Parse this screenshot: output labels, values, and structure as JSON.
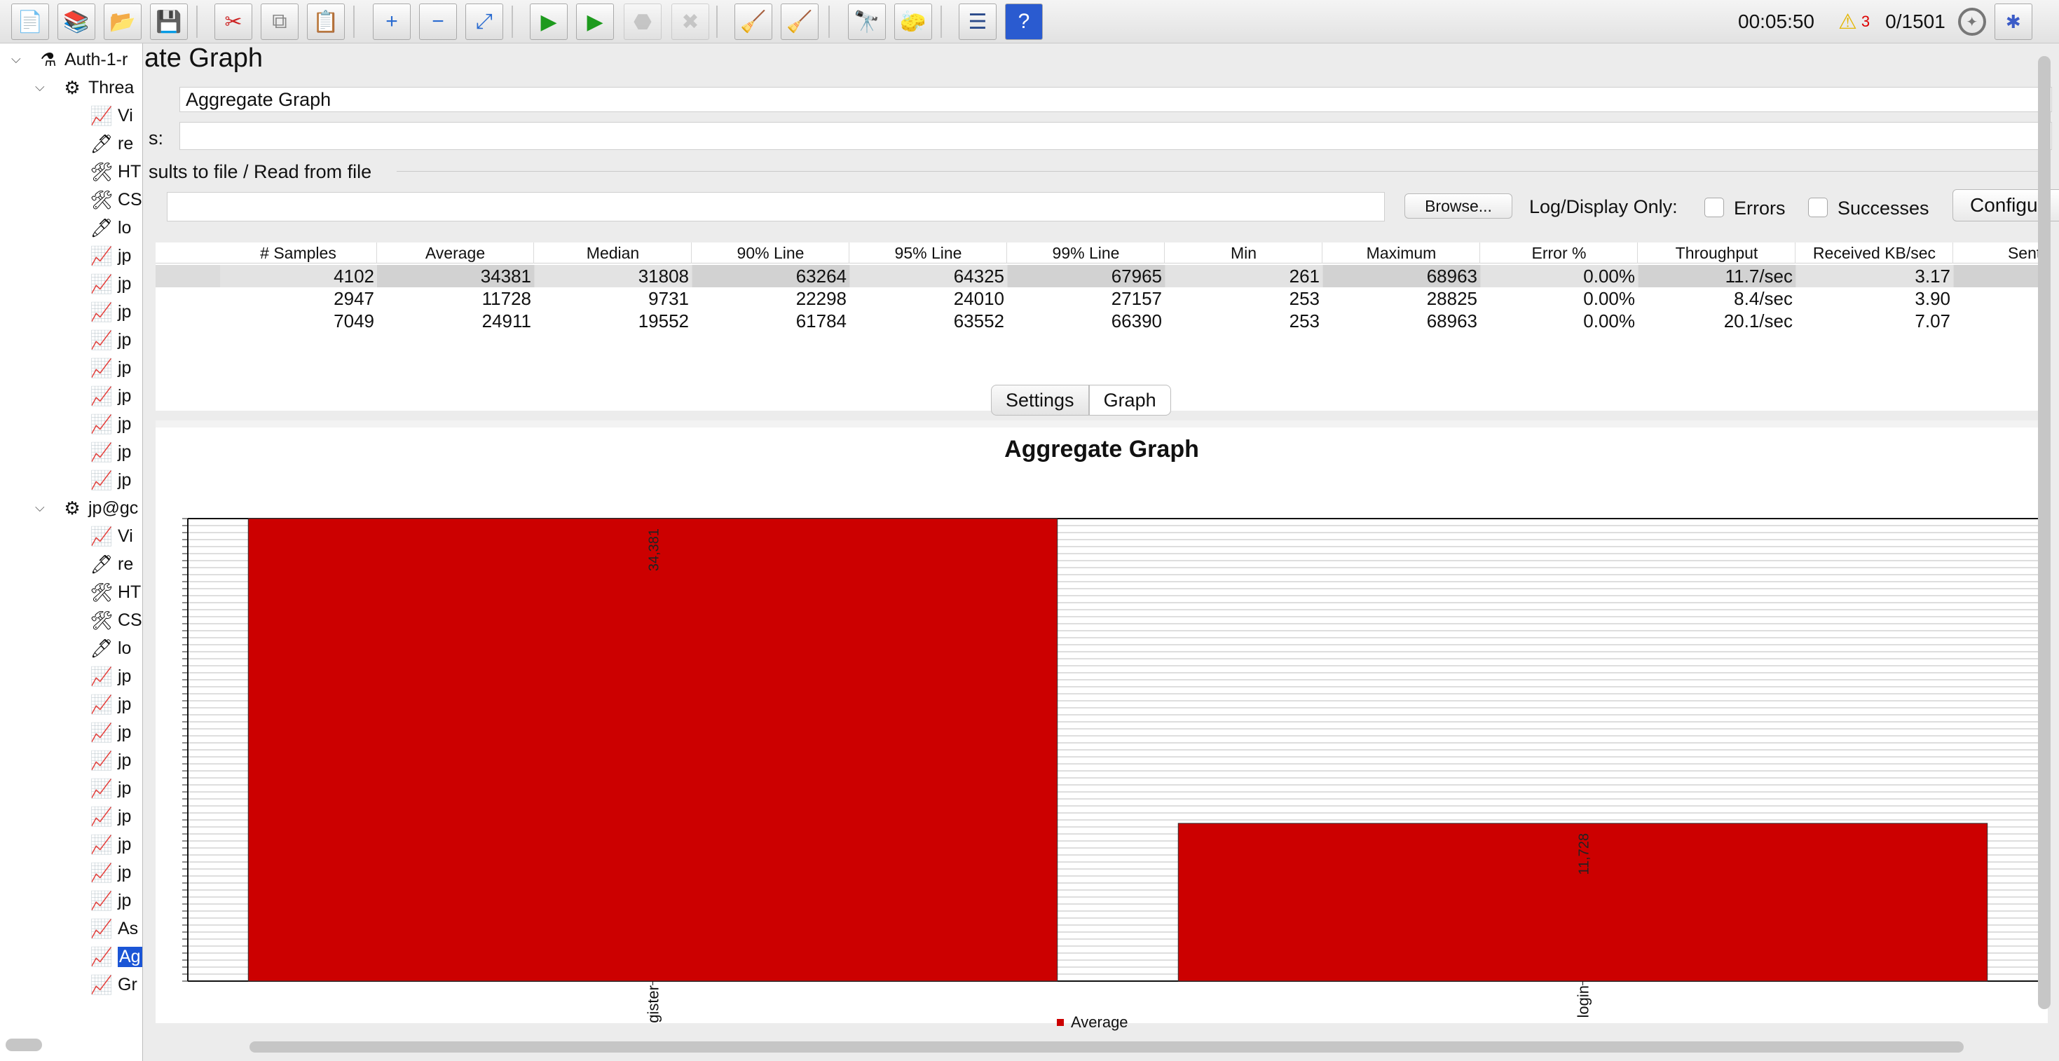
{
  "toolbar": {
    "buttons": [
      {
        "name": "new-icon",
        "glyph": "📄"
      },
      {
        "name": "templates-icon",
        "glyph": "📚"
      },
      {
        "name": "open-icon",
        "glyph": "📂"
      },
      {
        "name": "save-icon",
        "glyph": "💾"
      },
      {
        "name": "cut-icon",
        "glyph": "✂"
      },
      {
        "name": "copy-icon",
        "glyph": "⧉"
      },
      {
        "name": "paste-icon",
        "glyph": "📋"
      },
      {
        "name": "expand-icon",
        "glyph": "+"
      },
      {
        "name": "collapse-icon",
        "glyph": "−"
      },
      {
        "name": "toggle-icon",
        "glyph": "⤢"
      },
      {
        "name": "start-icon",
        "glyph": "▶"
      },
      {
        "name": "start-no-pauses-icon",
        "glyph": "▶"
      },
      {
        "name": "stop-icon",
        "glyph": "⬣"
      },
      {
        "name": "shutdown-icon",
        "glyph": "✖"
      },
      {
        "name": "clear-icon",
        "glyph": "🧹"
      },
      {
        "name": "clear-all-icon",
        "glyph": "🧹"
      },
      {
        "name": "search-icon",
        "glyph": "🔭"
      },
      {
        "name": "reset-search-icon",
        "glyph": "🧽"
      },
      {
        "name": "function-helper-icon",
        "glyph": "☰"
      },
      {
        "name": "help-icon",
        "glyph": "?"
      }
    ],
    "elapsed": "00:05:50",
    "warning_count": "3",
    "threads": "0/1501"
  },
  "tree": {
    "nodes": [
      {
        "label": "Auth-1-r",
        "icon": "flask-icon",
        "glyph": "⚗"
      },
      {
        "label": "Threa",
        "icon": "gear-icon",
        "glyph": "⚙"
      },
      {
        "label": "Vi",
        "icon": "graph-icon",
        "glyph": "📈"
      },
      {
        "label": "re",
        "icon": "pipette-icon",
        "glyph": "🖊"
      },
      {
        "label": "HT",
        "icon": "tools-icon",
        "glyph": "🛠"
      },
      {
        "label": "CS",
        "icon": "tools-icon",
        "glyph": "🛠"
      },
      {
        "label": "lo",
        "icon": "pipette-icon",
        "glyph": "🖊"
      },
      {
        "label": "jp",
        "icon": "graph-icon",
        "glyph": "📈"
      },
      {
        "label": "jp",
        "icon": "graph-icon",
        "glyph": "📈"
      },
      {
        "label": "jp",
        "icon": "graph-icon",
        "glyph": "📈"
      },
      {
        "label": "jp",
        "icon": "graph-icon",
        "glyph": "📈"
      },
      {
        "label": "jp",
        "icon": "graph-icon",
        "glyph": "📈"
      },
      {
        "label": "jp",
        "icon": "graph-icon",
        "glyph": "📈"
      },
      {
        "label": "jp",
        "icon": "graph-icon",
        "glyph": "📈"
      },
      {
        "label": "jp",
        "icon": "graph-icon",
        "glyph": "📈"
      },
      {
        "label": "jp",
        "icon": "graph-icon",
        "glyph": "📈"
      },
      {
        "label": "jp@gc",
        "icon": "gear-icon",
        "glyph": "⚙"
      },
      {
        "label": "Vi",
        "icon": "graph-icon",
        "glyph": "📈"
      },
      {
        "label": "re",
        "icon": "pipette-icon",
        "glyph": "🖊"
      },
      {
        "label": "HT",
        "icon": "tools-icon",
        "glyph": "🛠"
      },
      {
        "label": "CS",
        "icon": "tools-icon",
        "glyph": "🛠"
      },
      {
        "label": "lo",
        "icon": "pipette-icon",
        "glyph": "🖊"
      },
      {
        "label": "jp",
        "icon": "graph-icon",
        "glyph": "📈"
      },
      {
        "label": "jp",
        "icon": "graph-icon",
        "glyph": "📈"
      },
      {
        "label": "jp",
        "icon": "graph-icon",
        "glyph": "📈"
      },
      {
        "label": "jp",
        "icon": "graph-icon",
        "glyph": "📈"
      },
      {
        "label": "jp",
        "icon": "graph-icon",
        "glyph": "📈"
      },
      {
        "label": "jp",
        "icon": "graph-icon",
        "glyph": "📈"
      },
      {
        "label": "jp",
        "icon": "graph-icon",
        "glyph": "📈"
      },
      {
        "label": "jp",
        "icon": "graph-icon",
        "glyph": "📈"
      },
      {
        "label": "jp",
        "icon": "graph-icon",
        "glyph": "📈"
      },
      {
        "label": "As",
        "icon": "graph-icon",
        "glyph": "📈"
      },
      {
        "label": "Ag",
        "icon": "graph-icon",
        "glyph": "📈",
        "selected": true
      },
      {
        "label": "Gr",
        "icon": "graph-icon",
        "glyph": "📈"
      }
    ]
  },
  "panel": {
    "title": "ate Graph",
    "name_value": "Aggregate Graph",
    "comments_label": "s:",
    "comments_value": "",
    "file_group_label": "sults to file / Read from file",
    "filename_value": "",
    "browse_label": "Browse...",
    "log_display_label": "Log/Display Only:",
    "errors_label": "Errors",
    "successes_label": "Successes",
    "configure_label": "Configu"
  },
  "table": {
    "columns": [
      "# Samples",
      "Average",
      "Median",
      "90% Line",
      "95% Line",
      "99% Line",
      "Min",
      "Maximum",
      "Error %",
      "Throughput",
      "Received KB/sec",
      "Sent K"
    ],
    "rows": [
      [
        "4102",
        "34381",
        "31808",
        "63264",
        "64325",
        "67965",
        "261",
        "68963",
        "0.00%",
        "11.7/sec",
        "3.17",
        ""
      ],
      [
        "2947",
        "11728",
        "9731",
        "22298",
        "24010",
        "27157",
        "253",
        "28825",
        "0.00%",
        "8.4/sec",
        "3.90",
        ""
      ],
      [
        "7049",
        "24911",
        "19552",
        "61784",
        "63552",
        "66390",
        "253",
        "68963",
        "0.00%",
        "20.1/sec",
        "7.07",
        ""
      ]
    ]
  },
  "tabs": {
    "settings": "Settings",
    "graph": "Graph"
  },
  "chart_data": {
    "type": "bar",
    "title": "Aggregate Graph",
    "categories": [
      "register",
      "login"
    ],
    "series": [
      {
        "name": "Average",
        "values": [
          34381,
          11728
        ],
        "labels": [
          "34,381",
          "11,728"
        ]
      }
    ],
    "ylim": [
      0,
      34381
    ],
    "grid": true,
    "legend": "bottom-center",
    "bar_color": "#cc0000"
  },
  "colors": {
    "selection": "#1a55d6",
    "warning": "#f2c200"
  }
}
